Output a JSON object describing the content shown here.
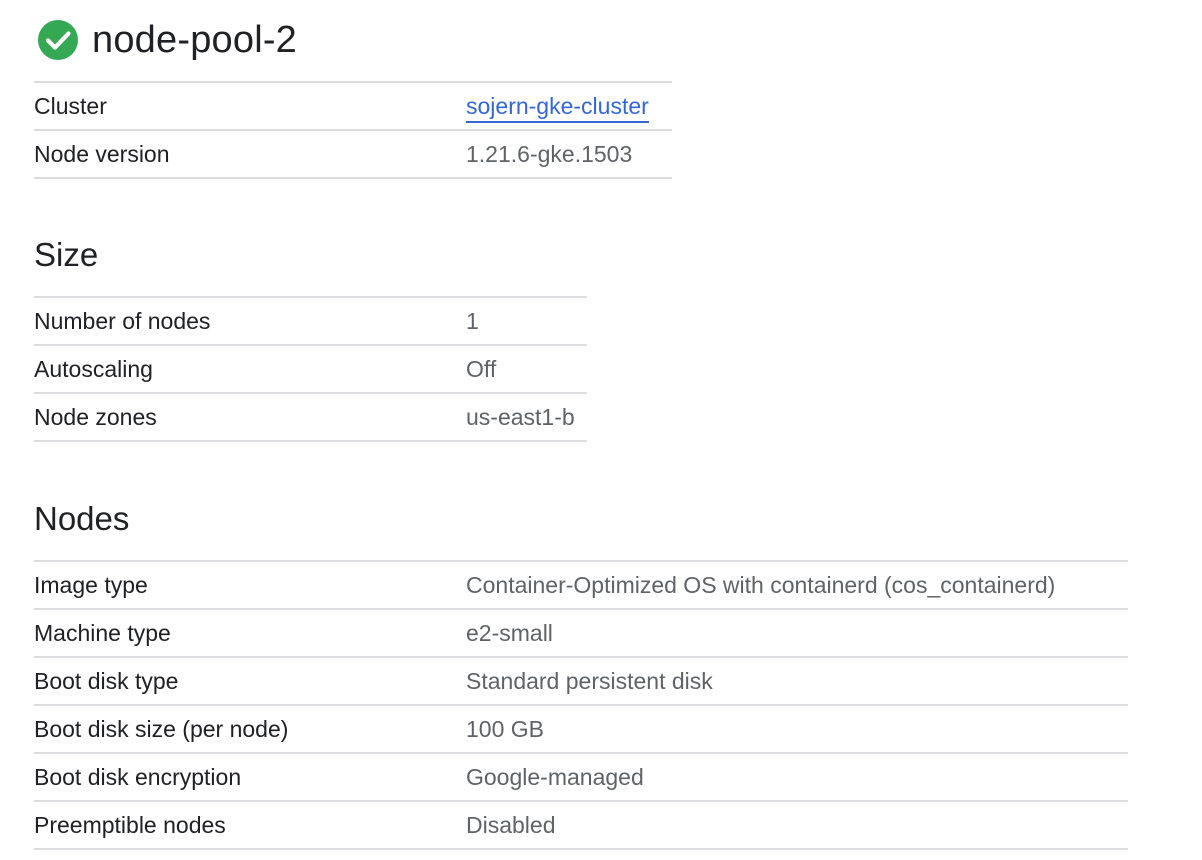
{
  "header": {
    "status_icon": "check-circle-icon",
    "status_color": "#34a853",
    "title": "node-pool-2"
  },
  "summary": {
    "rows": [
      {
        "label": "Cluster",
        "value": "sojern-gke-cluster",
        "is_link": true
      },
      {
        "label": "Node version",
        "value": "1.21.6-gke.1503"
      }
    ]
  },
  "size": {
    "title": "Size",
    "rows": [
      {
        "label": "Number of nodes",
        "value": "1"
      },
      {
        "label": "Autoscaling",
        "value": "Off"
      },
      {
        "label": "Node zones",
        "value": "us-east1-b"
      }
    ]
  },
  "nodes": {
    "title": "Nodes",
    "rows": [
      {
        "label": "Image type",
        "value": "Container-Optimized OS with containerd (cos_containerd)"
      },
      {
        "label": "Machine type",
        "value": "e2-small"
      },
      {
        "label": "Boot disk type",
        "value": "Standard persistent disk"
      },
      {
        "label": "Boot disk size (per node)",
        "value": "100 GB"
      },
      {
        "label": "Boot disk encryption",
        "value": "Google-managed"
      },
      {
        "label": "Preemptible nodes",
        "value": "Disabled"
      }
    ]
  },
  "colors": {
    "link": "#3367d6",
    "divider": "#dadce0",
    "value_text": "#5f6368",
    "label_text": "#202124"
  }
}
